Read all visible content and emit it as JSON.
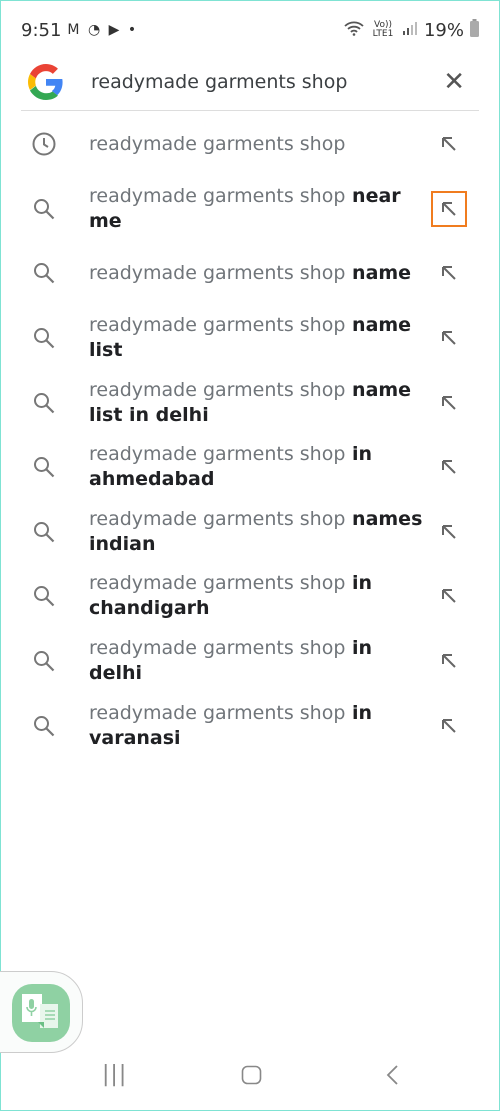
{
  "status": {
    "time": "9:51",
    "apps": "M ◔ ▶ •",
    "network": "Vo)) LTE1",
    "battery": "19%"
  },
  "search": {
    "query": "readymade garments shop"
  },
  "suggestions": [
    {
      "icon": "history-icon",
      "prefix": "readymade garments shop",
      "suffix": ""
    },
    {
      "icon": "search-icon",
      "prefix": "readymade garments shop",
      "suffix": " near me",
      "highlight": true
    },
    {
      "icon": "search-icon",
      "prefix": "readymade garments shop",
      "suffix": " name"
    },
    {
      "icon": "search-icon",
      "prefix": "readymade garments shop",
      "suffix": " name list"
    },
    {
      "icon": "search-icon",
      "prefix": "readymade garments shop",
      "suffix": " name list in delhi"
    },
    {
      "icon": "search-icon",
      "prefix": "readymade garments shop",
      "suffix": " in ahmedabad"
    },
    {
      "icon": "search-icon",
      "prefix": "readymade garments shop",
      "suffix": " names indian"
    },
    {
      "icon": "search-icon",
      "prefix": "readymade garments shop",
      "suffix": " in chandigarh"
    },
    {
      "icon": "search-icon",
      "prefix": "readymade garments shop",
      "suffix": " in delhi"
    },
    {
      "icon": "search-icon",
      "prefix": "readymade garments shop",
      "suffix": " in varanasi"
    }
  ],
  "colors": {
    "highlight": "#f07c1f",
    "voice_app": "#8fd1a3"
  }
}
